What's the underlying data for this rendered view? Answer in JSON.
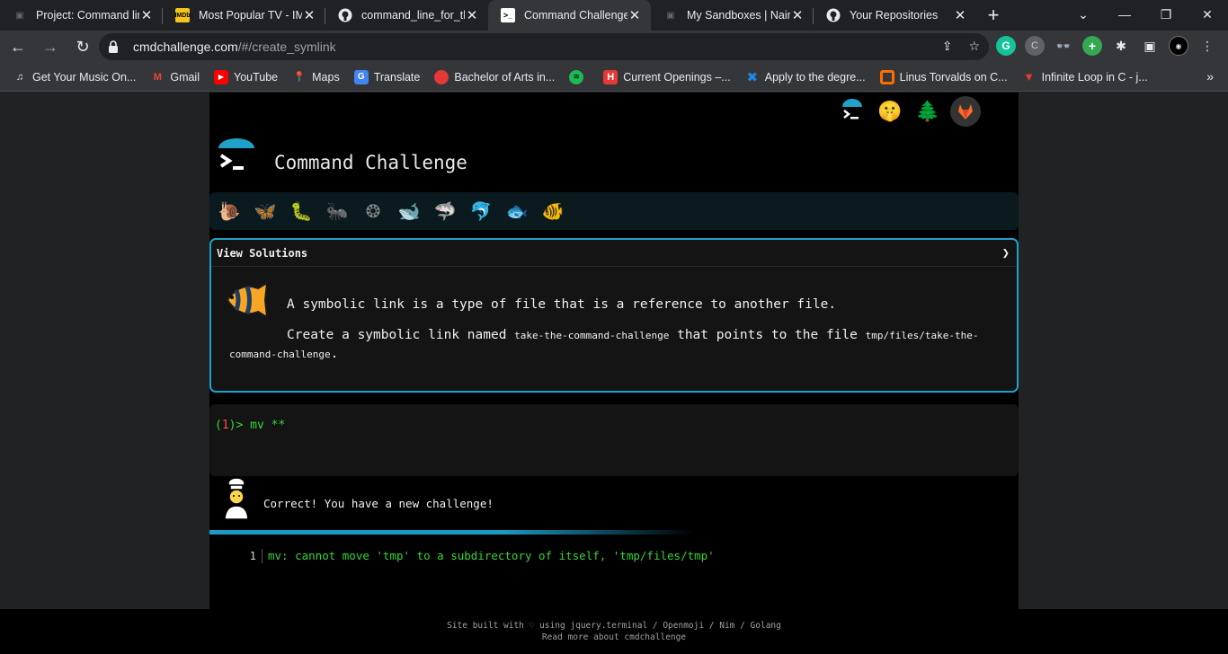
{
  "browser": {
    "tabs": [
      {
        "title": "Project: Command line",
        "favicon": "gitlab-icon",
        "active": false
      },
      {
        "title": "Most Popular TV - IMDb",
        "favicon": "imdb-icon",
        "active": false
      },
      {
        "title": "command_line_for_the",
        "favicon": "github-icon",
        "active": false
      },
      {
        "title": "Command Challenge!",
        "favicon": "terminal-icon",
        "active": true
      },
      {
        "title": "My Sandboxes | Nairobi",
        "favicon": "sandbox-icon",
        "active": false
      },
      {
        "title": "Your Repositories",
        "favicon": "github-icon",
        "active": false
      }
    ],
    "url_host": "cmdchallenge.com",
    "url_path": "/#/create_symlink",
    "bookmarks": [
      {
        "label": "Get Your Music On...",
        "icon": "music-icon",
        "color": "#e8eaed"
      },
      {
        "label": "Gmail",
        "icon": "gmail-icon",
        "color": "#ea4335"
      },
      {
        "label": "YouTube",
        "icon": "youtube-icon",
        "color": "#ff0000"
      },
      {
        "label": "Maps",
        "icon": "maps-icon",
        "color": "#34a853"
      },
      {
        "label": "Translate",
        "icon": "translate-icon",
        "color": "#4285f4"
      },
      {
        "label": "Bachelor of Arts in...",
        "icon": "school-icon",
        "color": "#e53935"
      },
      {
        "label": "",
        "icon": "spotify-icon",
        "color": "#1db954"
      },
      {
        "label": "Current Openings –...",
        "icon": "hack-icon",
        "color": "#e53935"
      },
      {
        "label": "Apply to the degre...",
        "icon": "apply-icon",
        "color": "#1e88e5"
      },
      {
        "label": "Linus Torvalds on C...",
        "icon": "orange-square-icon",
        "color": "#ff6d00"
      },
      {
        "label": "Infinite Loop in C - j...",
        "icon": "vivaldi-icon",
        "color": "#e53935"
      }
    ]
  },
  "page": {
    "title": "Command Challenge",
    "panel_header": "View Solutions",
    "description_1": "A symbolic link is a type of file that is a reference to another file.",
    "description_2_prefix": "Create a symbolic link named ",
    "description_2_code1": "take-the-command-challenge",
    "description_2_mid": " that points to the file ",
    "description_2_code2": "tmp/files/take-the-command-challenge",
    "description_2_suffix": ".",
    "prompt_open": "(",
    "prompt_num": "1",
    "prompt_close": ")>",
    "command": "mv **",
    "result_message": "Correct! You have a new challenge!",
    "output_line_number": "1",
    "output_text": "mv: cannot move 'tmp' to a subdirectory of itself, 'tmp/files/tmp'",
    "footer_line1": "Site built with ♡ using jquery.terminal / Openmoji / Nim / Golang",
    "footer_line2": "Read more about cmdchallenge",
    "accent_color": "#1fa2c9",
    "prompt_color": "#36d636"
  }
}
